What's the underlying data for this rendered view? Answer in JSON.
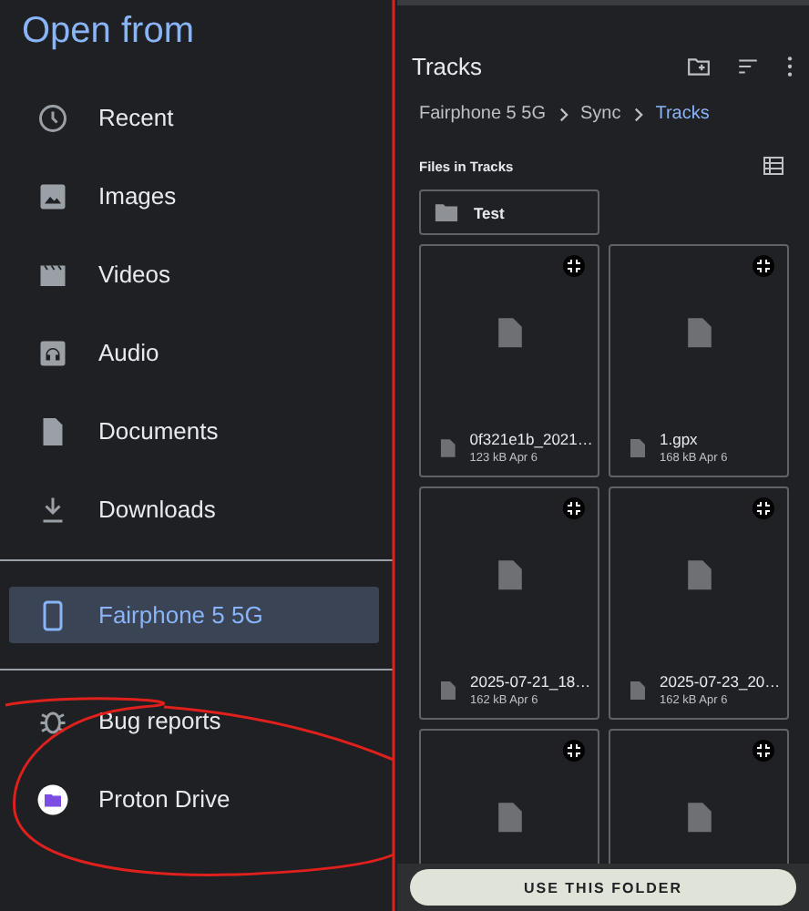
{
  "drawer": {
    "title": "Open from",
    "groups": [
      {
        "items": [
          {
            "kind": "recent",
            "label": "Recent",
            "selected": false
          },
          {
            "kind": "images",
            "label": "Images",
            "selected": false
          },
          {
            "kind": "videos",
            "label": "Videos",
            "selected": false
          },
          {
            "kind": "audio",
            "label": "Audio",
            "selected": false
          },
          {
            "kind": "documents",
            "label": "Documents",
            "selected": false
          },
          {
            "kind": "downloads",
            "label": "Downloads",
            "selected": false
          }
        ]
      },
      {
        "items": [
          {
            "kind": "device",
            "label": "Fairphone 5 5G",
            "selected": true
          }
        ]
      },
      {
        "items": [
          {
            "kind": "bug",
            "label": "Bug reports",
            "selected": false
          },
          {
            "kind": "drive",
            "label": "Proton Drive",
            "selected": false
          }
        ]
      }
    ]
  },
  "folder_view": {
    "title": "Tracks",
    "breadcrumb": [
      {
        "label": "Fairphone 5 5G",
        "selected": false
      },
      {
        "label": "Sync",
        "selected": false
      },
      {
        "label": "Tracks",
        "selected": true
      }
    ],
    "section_label": "Files in Tracks",
    "folders": [
      {
        "name": "Test"
      }
    ],
    "files": [
      {
        "kind": "file",
        "name": "0f321e1b_2021…",
        "meta": "123 kB Apr 6"
      },
      {
        "kind": "file",
        "name": "1.gpx",
        "meta": "168 kB Apr 6"
      },
      {
        "kind": "file",
        "name": "2025-07-21_18…",
        "meta": "162 kB Apr 6"
      },
      {
        "kind": "file",
        "name": "2025-07-23_20…",
        "meta": "162 kB Apr 6"
      },
      {
        "kind": "file"
      },
      {
        "kind": "file"
      }
    ],
    "action_button": "USE THIS FOLDER"
  }
}
